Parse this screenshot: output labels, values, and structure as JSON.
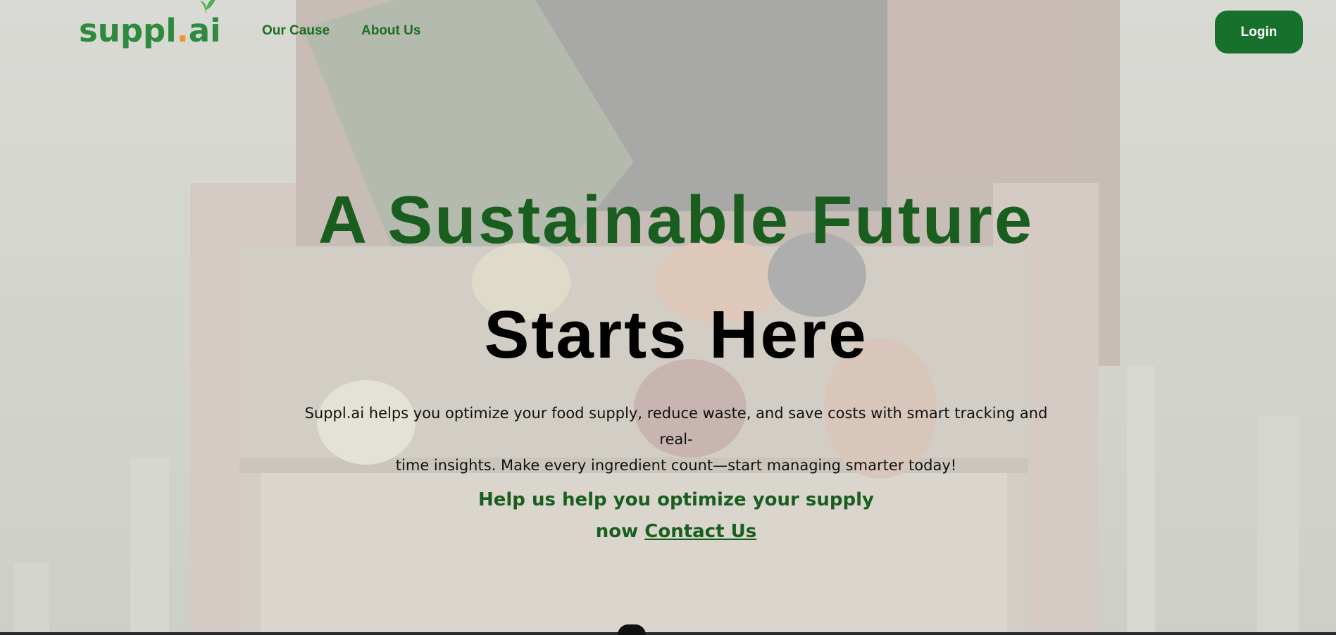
{
  "brand": {
    "logo_main": "suppl",
    "logo_dot": ".",
    "logo_ai": "ai"
  },
  "nav": {
    "links": [
      {
        "label": "Our Cause"
      },
      {
        "label": "About Us"
      }
    ],
    "login_label": "Login"
  },
  "hero": {
    "title_line1": "A Sustainable Future",
    "title_line2": "Starts Here",
    "subtitle_line1": "Suppl.ai helps you optimize your food supply, reduce waste, and save costs with smart tracking and real-",
    "subtitle_line2": "time insights. Make every ingredient count—start managing smarter today!",
    "cta_line1": "Help us help you optimize your supply",
    "cta_prefix": "now",
    "cta_link": "Contact Us"
  },
  "colors": {
    "brand_green": "#2e8a3e",
    "dark_green": "#1a5e1f",
    "button_green": "#17702b",
    "logo_dot": "#f0932b"
  },
  "icons": {
    "logo_leaf": "leaf-icon"
  }
}
